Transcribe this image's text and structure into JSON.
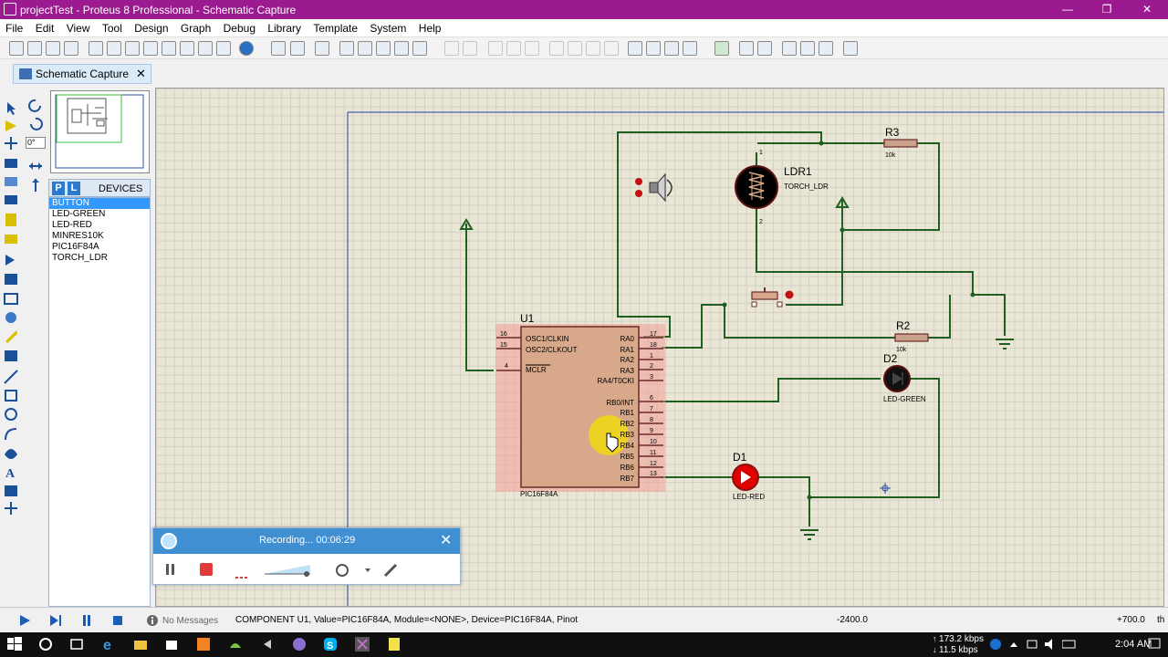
{
  "window": {
    "title": "projectTest - Proteus 8 Professional - Schematic Capture",
    "controls": {
      "minimize": "—",
      "restore": "❐",
      "close": "✕"
    }
  },
  "menu": [
    "File",
    "Edit",
    "View",
    "Tool",
    "Design",
    "Graph",
    "Debug",
    "Library",
    "Template",
    "System",
    "Help"
  ],
  "tab": {
    "label": "Schematic Capture",
    "close": "✕"
  },
  "rotation": {
    "value": "0°"
  },
  "devices": {
    "header": "DEVICES",
    "p_button": "P",
    "l_button": "L",
    "items": [
      "BUTTON",
      "LED-GREEN",
      "LED-RED",
      "MINRES10K",
      "PIC16F84A",
      "TORCH_LDR"
    ],
    "selected": "BUTTON"
  },
  "schematic": {
    "u1": {
      "ref": "U1",
      "part": "PIC16F84A",
      "left_pins": [
        {
          "num": "16",
          "name": "OSC1/CLKIN"
        },
        {
          "num": "15",
          "name": "OSC2/CLKOUT"
        },
        {
          "num": "4",
          "name": "MCLR"
        }
      ],
      "right_pins": [
        {
          "num": "17",
          "name": "RA0"
        },
        {
          "num": "18",
          "name": "RA1"
        },
        {
          "num": "1",
          "name": "RA2"
        },
        {
          "num": "2",
          "name": "RA3"
        },
        {
          "num": "3",
          "name": "RA4/T0CKI"
        },
        {
          "num": "6",
          "name": "RB0/INT"
        },
        {
          "num": "7",
          "name": "RB1"
        },
        {
          "num": "8",
          "name": "RB2"
        },
        {
          "num": "9",
          "name": "RB3"
        },
        {
          "num": "10",
          "name": "RB4"
        },
        {
          "num": "11",
          "name": "RB5"
        },
        {
          "num": "12",
          "name": "RB6"
        },
        {
          "num": "13",
          "name": "RB7"
        }
      ]
    },
    "r3": {
      "ref": "R3",
      "value": "10k"
    },
    "r2": {
      "ref": "R2",
      "value": "10k"
    },
    "ldr1": {
      "ref": "LDR1",
      "value": "TORCH_LDR",
      "pin1": "1",
      "pin2": "2"
    },
    "d2": {
      "ref": "D2",
      "value": "LED-GREEN"
    },
    "d1": {
      "ref": "D1",
      "value": "LED-RED"
    }
  },
  "recorder": {
    "text": "Recording... 00:06:29",
    "close": "✕"
  },
  "status": {
    "messages": "No Messages",
    "component": "COMPONENT U1, Value=PIC16F84A, Module=<NONE>, Device=PIC16F84A, Pinot",
    "x": "-2400.0",
    "y": "+700.0",
    "extra": "th"
  },
  "taskbar": {
    "net_up": "173.2 kbps",
    "net_down": "11.5 kbps",
    "time": "2:04 AM"
  },
  "colors": {
    "title_bar": "#9b1a8f",
    "wire": "#1a5c1a",
    "component_body": "#d8a88a",
    "led_red": "#e10000",
    "canvas": "#e9e6d6"
  }
}
